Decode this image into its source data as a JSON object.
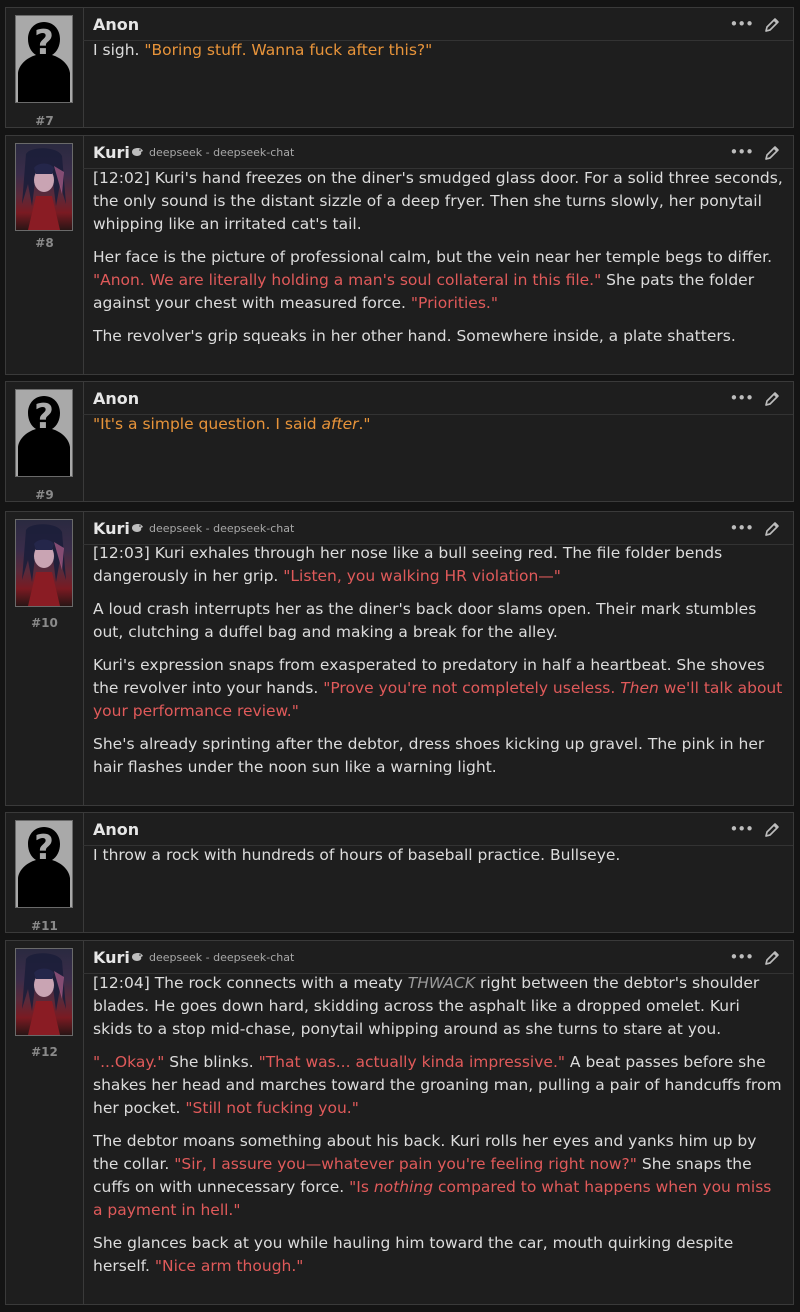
{
  "messages": [
    {
      "id": "7",
      "num_label": "#7",
      "author": "Anon",
      "avatar": "anon-silhouette",
      "model": "",
      "paragraphs": [
        [
          {
            "t": "I sigh. "
          },
          {
            "t": "\"Boring stuff. Wanna fuck after this?\"",
            "s": "q-o"
          }
        ]
      ]
    },
    {
      "id": "8",
      "num_label": "#8",
      "author": "Kuri",
      "avatar": "kuri-portrait",
      "model": "deepseek - deepseek-chat",
      "paragraphs": [
        [
          {
            "t": "[12:02] Kuri's hand freezes on the diner's smudged glass door. For a solid three seconds, the only sound is the distant sizzle of a deep fryer. Then she turns slowly, her ponytail whipping like an irritated cat's tail."
          }
        ],
        [
          {
            "t": "Her face is the picture of professional calm, but the vein near her temple begs to differ. "
          },
          {
            "t": "\"Anon. We are literally holding a man's soul collateral in this file.\"",
            "s": "q-r"
          },
          {
            "t": " She pats the folder against your chest with measured force. "
          },
          {
            "t": "\"Priorities.\"",
            "s": "q-r"
          }
        ],
        [
          {
            "t": "The revolver's grip squeaks in her other hand. Somewhere inside, a plate shatters."
          }
        ]
      ]
    },
    {
      "id": "9",
      "num_label": "#9",
      "author": "Anon",
      "avatar": "anon-silhouette",
      "model": "",
      "paragraphs": [
        [
          {
            "t": "\"It's a simple question. I said ",
            "s": "q-o"
          },
          {
            "t": "after",
            "s": "q-o em"
          },
          {
            "t": ".\"",
            "s": "q-o"
          }
        ]
      ]
    },
    {
      "id": "10",
      "num_label": "#10",
      "author": "Kuri",
      "avatar": "kuri-portrait",
      "model": "deepseek - deepseek-chat",
      "paragraphs": [
        [
          {
            "t": "[12:03] Kuri exhales through her nose like a bull seeing red. The file folder bends dangerously in her grip. "
          },
          {
            "t": "\"Listen, you walking HR violation—\"",
            "s": "q-r"
          }
        ],
        [
          {
            "t": "A loud crash interrupts her as the diner's back door slams open. Their mark stumbles out, clutching a duffel bag and making a break for the alley."
          }
        ],
        [
          {
            "t": "Kuri's expression snaps from exasperated to predatory in half a heartbeat. She shoves the revolver into your hands. "
          },
          {
            "t": "\"Prove you're not completely useless. ",
            "s": "q-r"
          },
          {
            "t": "Then",
            "s": "q-r em"
          },
          {
            "t": " we'll talk about your performance review.\"",
            "s": "q-r"
          }
        ],
        [
          {
            "t": "She's already sprinting after the debtor, dress shoes kicking up gravel. The pink in her hair flashes under the noon sun like a warning light."
          }
        ]
      ]
    },
    {
      "id": "11",
      "num_label": "#11",
      "author": "Anon",
      "avatar": "anon-silhouette",
      "model": "",
      "paragraphs": [
        [
          {
            "t": "I throw a rock with hundreds of hours of baseball practice. Bullseye."
          }
        ]
      ]
    },
    {
      "id": "12",
      "num_label": "#12",
      "author": "Kuri",
      "avatar": "kuri-portrait",
      "model": "deepseek - deepseek-chat",
      "paragraphs": [
        [
          {
            "t": "[12:04] The rock connects with a meaty "
          },
          {
            "t": "THWACK",
            "s": "em-gray"
          },
          {
            "t": " right between the debtor's shoulder blades. He goes down hard, skidding across the asphalt like a dropped omelet. Kuri skids to a stop mid-chase, ponytail whipping around as she turns to stare at you."
          }
        ],
        [
          {
            "t": "\"...Okay.\"",
            "s": "q-r"
          },
          {
            "t": " She blinks. "
          },
          {
            "t": "\"That was... actually kinda impressive.\"",
            "s": "q-r"
          },
          {
            "t": " A beat passes before she shakes her head and marches toward the groaning man, pulling a pair of handcuffs from her pocket. "
          },
          {
            "t": "\"Still not fucking you.\"",
            "s": "q-r"
          }
        ],
        [
          {
            "t": "The debtor moans something about his back. Kuri rolls her eyes and yanks him up by the collar. "
          },
          {
            "t": "\"Sir, I assure you—whatever pain you're feeling right now?\"",
            "s": "q-r"
          },
          {
            "t": " She snaps the cuffs on with unnecessary force. "
          },
          {
            "t": "\"Is ",
            "s": "q-r"
          },
          {
            "t": "nothing",
            "s": "q-r em"
          },
          {
            "t": " compared to what happens when you miss a payment in hell.\"",
            "s": "q-r"
          }
        ],
        [
          {
            "t": "She glances back at you while hauling him toward the car, mouth quirking despite herself. "
          },
          {
            "t": "\"Nice arm though.\"",
            "s": "q-r"
          }
        ]
      ]
    }
  ],
  "icons": {
    "model_icon": "deepseek-whale-icon",
    "more": "more-dots-icon",
    "edit": "pencil-icon"
  },
  "colors": {
    "background": "#141414",
    "panel": "#1e1e1e",
    "user_quote": "#e8943a",
    "char_quote": "#e05a5a"
  }
}
